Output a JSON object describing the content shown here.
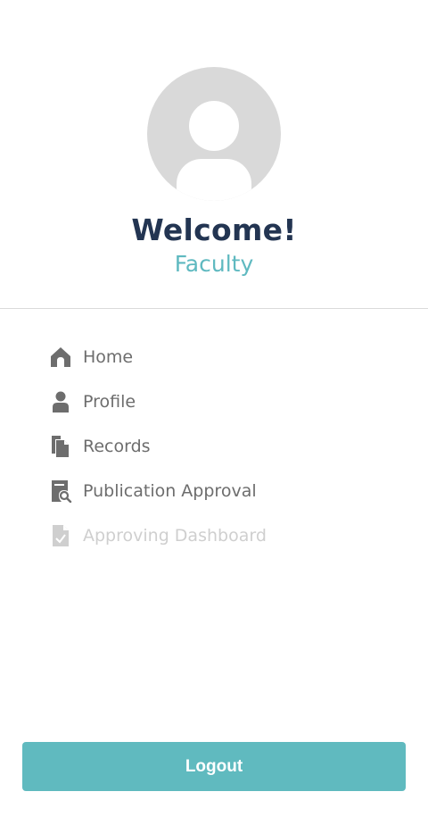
{
  "header": {
    "welcome_text": "Welcome!",
    "role_text": "Faculty"
  },
  "menu": {
    "items": [
      {
        "label": "Home",
        "icon": "home-icon",
        "enabled": true
      },
      {
        "label": "Profile",
        "icon": "person-icon",
        "enabled": true
      },
      {
        "label": "Records",
        "icon": "documents-icon",
        "enabled": true
      },
      {
        "label": "Publication Approval",
        "icon": "document-search-icon",
        "enabled": true
      },
      {
        "label": "Approving Dashboard",
        "icon": "document-check-icon",
        "enabled": false
      }
    ]
  },
  "footer": {
    "logout_label": "Logout"
  },
  "colors": {
    "title": "#233552",
    "accent": "#5fb9c0",
    "menu_text": "#6d6d6d",
    "disabled": "#cfcfcf",
    "button": "#60babf"
  }
}
